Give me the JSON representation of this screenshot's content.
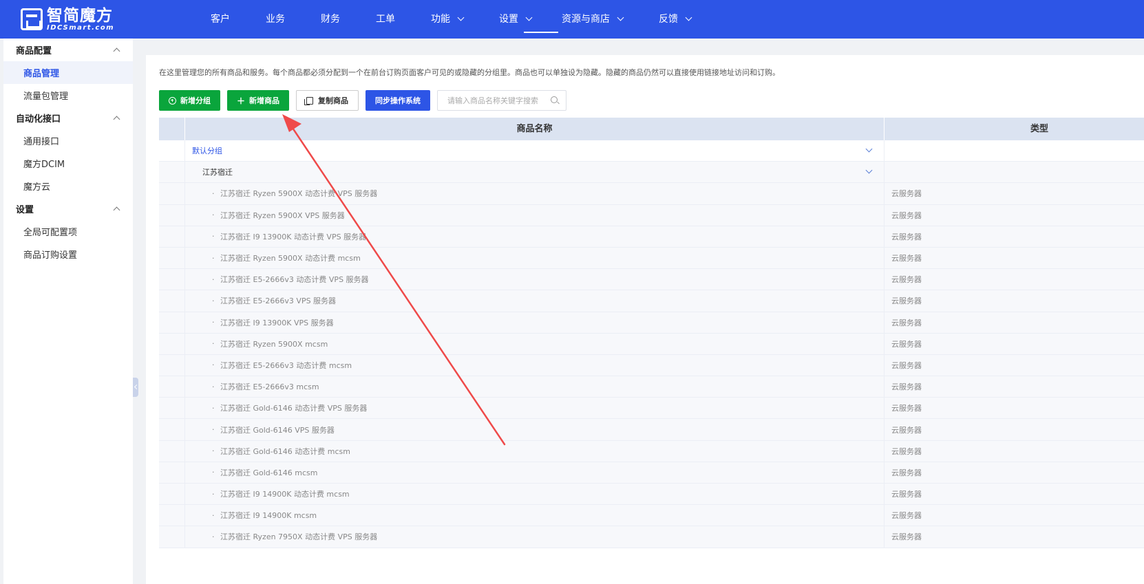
{
  "brand": {
    "name": "智简魔方",
    "sub": "IDCSmart.com"
  },
  "nav": [
    {
      "label": "客户",
      "dropdown": false
    },
    {
      "label": "业务",
      "dropdown": false
    },
    {
      "label": "财务",
      "dropdown": false
    },
    {
      "label": "工单",
      "dropdown": false
    },
    {
      "label": "功能",
      "dropdown": true
    },
    {
      "label": "设置",
      "dropdown": true,
      "active": true
    },
    {
      "label": "资源与商店",
      "dropdown": true
    },
    {
      "label": "反馈",
      "dropdown": true
    }
  ],
  "sidebar": {
    "groups": [
      {
        "title": "商品配置",
        "items": [
          "商品管理",
          "流量包管理"
        ]
      },
      {
        "title": "自动化接口",
        "items": [
          "通用接口",
          "魔方DCIM",
          "魔方云"
        ]
      },
      {
        "title": "设置",
        "items": [
          "全局可配置项",
          "商品订购设置"
        ]
      }
    ],
    "active": "商品管理"
  },
  "main": {
    "description": "在这里管理您的所有商品和服务。每个商品都必须分配到一个在前台订购页面客户可见的或隐藏的分组里。商品也可以单独设为隐藏。隐藏的商品仍然可以直接使用链接地址访问和订购。",
    "toolbar": {
      "add_group": "新增分组",
      "add_product": "新增商品",
      "copy_product": "复制商品",
      "sync_os": "同步操作系统",
      "search_placeholder": "请输入商品名称关键字搜索"
    },
    "table": {
      "columns": [
        "商品名称",
        "类型"
      ],
      "group": "默认分组",
      "subgroup": "江苏宿迁",
      "rows": [
        {
          "name": "江苏宿迁 Ryzen 5900X 动态计费 VPS 服务器",
          "type": "云服务器"
        },
        {
          "name": "江苏宿迁 Ryzen 5900X VPS 服务器",
          "type": "云服务器"
        },
        {
          "name": "江苏宿迁 I9 13900K 动态计费 VPS 服务器",
          "type": "云服务器"
        },
        {
          "name": "江苏宿迁 Ryzen 5900X 动态计费 mcsm",
          "type": "云服务器"
        },
        {
          "name": "江苏宿迁 E5-2666v3 动态计费 VPS 服务器",
          "type": "云服务器"
        },
        {
          "name": "江苏宿迁 E5-2666v3 VPS 服务器",
          "type": "云服务器"
        },
        {
          "name": "江苏宿迁 I9 13900K VPS 服务器",
          "type": "云服务器"
        },
        {
          "name": "江苏宿迁 Ryzen 5900X mcsm",
          "type": "云服务器"
        },
        {
          "name": "江苏宿迁 E5-2666v3 动态计费 mcsm",
          "type": "云服务器"
        },
        {
          "name": "江苏宿迁 E5-2666v3 mcsm",
          "type": "云服务器"
        },
        {
          "name": "江苏宿迁 Gold-6146 动态计费 VPS 服务器",
          "type": "云服务器"
        },
        {
          "name": "江苏宿迁 Gold-6146 VPS 服务器",
          "type": "云服务器"
        },
        {
          "name": "江苏宿迁 Gold-6146 动态计费 mcsm",
          "type": "云服务器"
        },
        {
          "name": "江苏宿迁 Gold-6146 mcsm",
          "type": "云服务器"
        },
        {
          "name": "江苏宿迁 I9 14900K 动态计费 mcsm",
          "type": "云服务器"
        },
        {
          "name": "江苏宿迁 I9 14900K mcsm",
          "type": "云服务器"
        },
        {
          "name": "江苏宿迁 Ryzen 7950X 动态计费 VPS 服务器",
          "type": "云服务器"
        }
      ]
    }
  },
  "colors": {
    "primary": "#2d55e6",
    "success": "#0aa53c",
    "annotation": "#ef4a4a"
  }
}
